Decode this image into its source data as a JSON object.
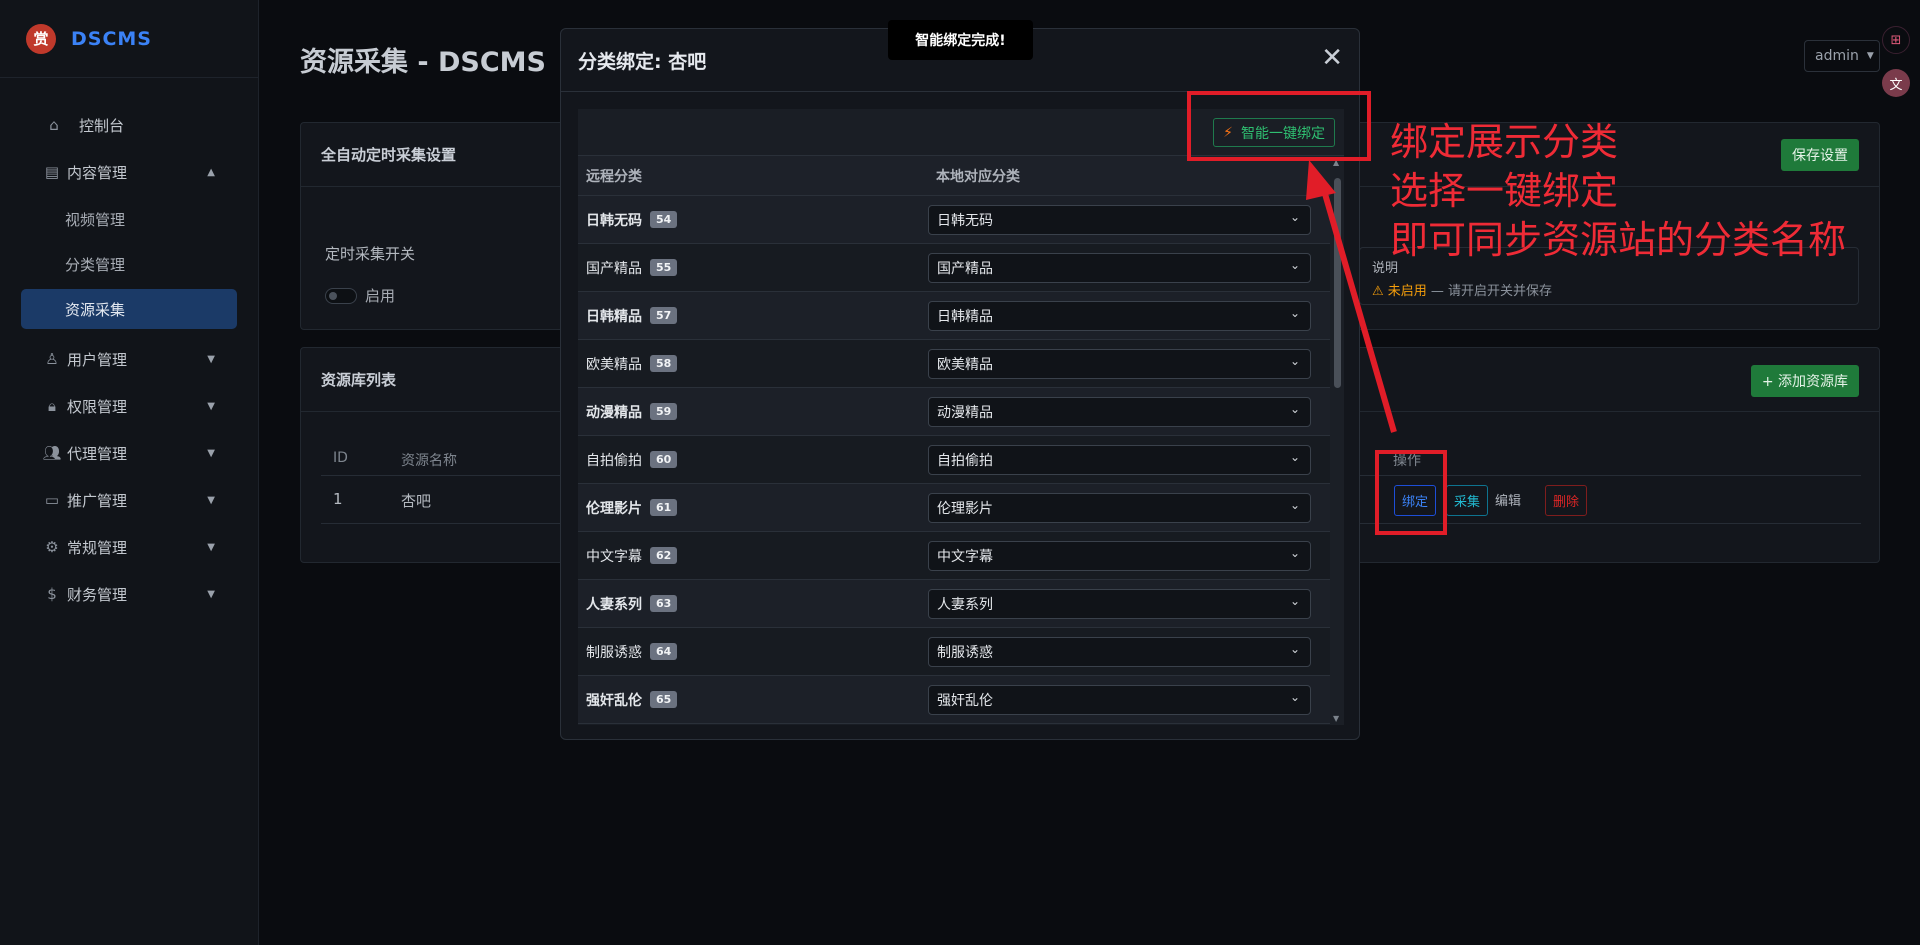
{
  "brand": {
    "logo_glyph": "赏",
    "name": "DSCMS"
  },
  "sidebar": {
    "dashboard": "控制台",
    "content": "内容管理",
    "sub": [
      "视频管理",
      "分类管理",
      "资源采集"
    ],
    "items": [
      "用户管理",
      "权限管理",
      "代理管理",
      "推广管理",
      "常规管理",
      "财务管理"
    ]
  },
  "page": {
    "title": "资源采集 - DSCMS"
  },
  "auto_card": {
    "title": "全自动定时采集设置",
    "save_label": "保存设置",
    "switch_label": "定时采集开关",
    "enable_label": "启用",
    "note_title": "说明",
    "note_status": "⚠ 未启用",
    "note_rest": " — 请开启开关并保存"
  },
  "lib_card": {
    "title": "资源库列表",
    "add_label": "+ 添加资源库",
    "columns": {
      "id": "ID",
      "name": "资源名称",
      "ops": "操作"
    },
    "row": {
      "id": "1",
      "name": "杏吧",
      "bind": "绑定",
      "collect": "采集",
      "edit": "编辑",
      "delete": "删除"
    }
  },
  "header": {
    "user": "admin"
  },
  "modal": {
    "title": "分类绑定: 杏吧",
    "smart_label": "智能一键绑定",
    "col_remote": "远程分类",
    "col_local": "本地对应分类",
    "rows": [
      {
        "name": "日韩无码",
        "id": "54",
        "local": "日韩无码"
      },
      {
        "name": "国产精品",
        "id": "55",
        "local": "国产精品"
      },
      {
        "name": "日韩精品",
        "id": "57",
        "local": "日韩精品"
      },
      {
        "name": "欧美精品",
        "id": "58",
        "local": "欧美精品"
      },
      {
        "name": "动漫精品",
        "id": "59",
        "local": "动漫精品"
      },
      {
        "name": "自拍偷拍",
        "id": "60",
        "local": "自拍偷拍"
      },
      {
        "name": "伦理影片",
        "id": "61",
        "local": "伦理影片"
      },
      {
        "name": "中文字幕",
        "id": "62",
        "local": "中文字幕"
      },
      {
        "name": "人妻系列",
        "id": "63",
        "local": "人妻系列"
      },
      {
        "name": "制服诱惑",
        "id": "64",
        "local": "制服诱惑"
      },
      {
        "name": "强奸乱伦",
        "id": "65",
        "local": "强奸乱伦"
      }
    ]
  },
  "toast": "智能绑定完成!",
  "annotation": [
    "绑定展示分类",
    "选择一键绑定",
    "即可同步资源站的分类名称"
  ]
}
